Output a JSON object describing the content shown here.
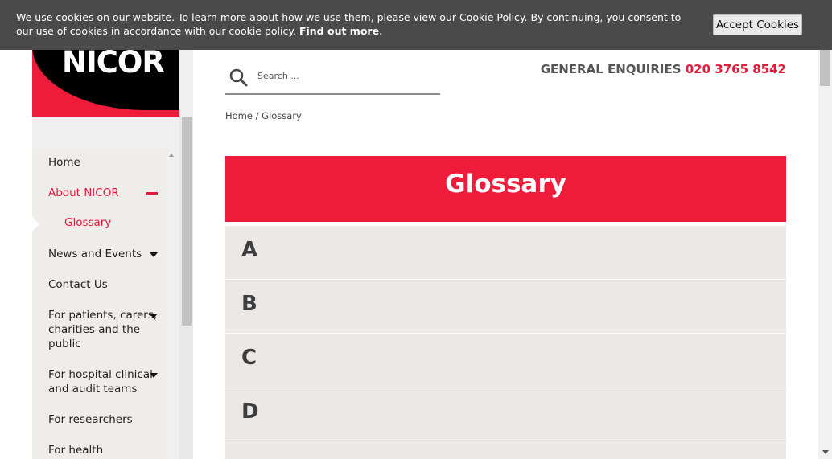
{
  "cookie_banner": {
    "text": "We use cookies on our website. To learn more about how we use them, please view our Cookie Policy. By continuing, you consent to our use of cookies in accordance with our cookie policy.",
    "link": "Find out more",
    "button": "Accept Cookies"
  },
  "logo": {
    "text": "NICOR"
  },
  "header": {
    "search_placeholder": "Search ...",
    "enquiries_label": "GENERAL ENQUIRIES",
    "phone": "020 3765 8542"
  },
  "breadcrumb": {
    "home": "Home",
    "separator": "/",
    "current": "Glossary"
  },
  "nav": {
    "home": "Home",
    "about": "About NICOR",
    "glossary": "Glossary",
    "news": "News and Events",
    "contact": "Contact Us",
    "patients": [
      "For patients, carers,",
      "charities and the",
      "public"
    ],
    "hospital": [
      "For hospital clinical",
      "and audit teams"
    ],
    "researchers": "For researchers",
    "health": "For health"
  },
  "page": {
    "title": "Glossary",
    "letters": [
      "A",
      "B",
      "C",
      "D"
    ]
  },
  "colors": {
    "brand_red": "#ee1b3a",
    "banner_bg": "#4a4a4a",
    "row_bg": "#ece8e5"
  }
}
